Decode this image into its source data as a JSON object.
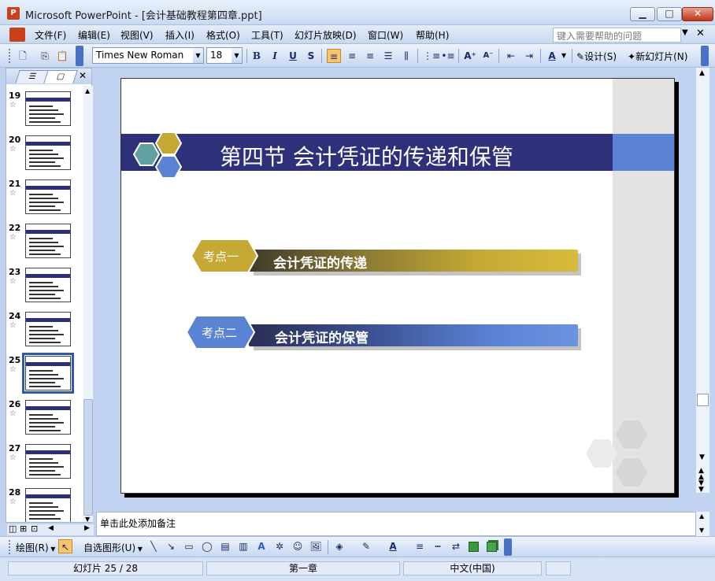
{
  "window": {
    "title": "Microsoft PowerPoint - [会计基础教程第四章.ppt]",
    "app_icon": "powerpoint-icon",
    "controls": [
      "minimize-icon",
      "maximize-icon",
      "close-icon"
    ]
  },
  "menu": {
    "items": [
      "文件(F)",
      "编辑(E)",
      "视图(V)",
      "插入(I)",
      "格式(O)",
      "工具(T)",
      "幻灯片放映(D)",
      "窗口(W)",
      "帮助(H)"
    ],
    "help_placeholder": "键入需要帮助的问题"
  },
  "toolbar": {
    "font": "Times New Roman",
    "size": "18",
    "design_label": "设计(S)",
    "new_slide_label": "新幻灯片(N)"
  },
  "thumbnails": {
    "numbers": [
      "19",
      "20",
      "21",
      "22",
      "23",
      "24",
      "25",
      "26",
      "27",
      "28"
    ],
    "selected": "25",
    "star": "☆"
  },
  "slide": {
    "title": "第四节  会计凭证的传递和保管",
    "point1": {
      "tag": "考点一",
      "text": "会计凭证的传递"
    },
    "point2": {
      "tag": "考点二",
      "text": "会计凭证的保管"
    }
  },
  "notes": {
    "placeholder": "单击此处添加备注"
  },
  "drawbar": {
    "draw_label": "绘图(R)",
    "autoshape_label": "自选图形(U)"
  },
  "status": {
    "slide_info": "幻灯片 25 / 28",
    "design": "第一章",
    "language": "中文(中国)"
  },
  "colors": {
    "title_band": "#2e307a",
    "accent_blue": "#5b83d4",
    "gold": "#c6a934",
    "teal": "#5fa0a0"
  }
}
